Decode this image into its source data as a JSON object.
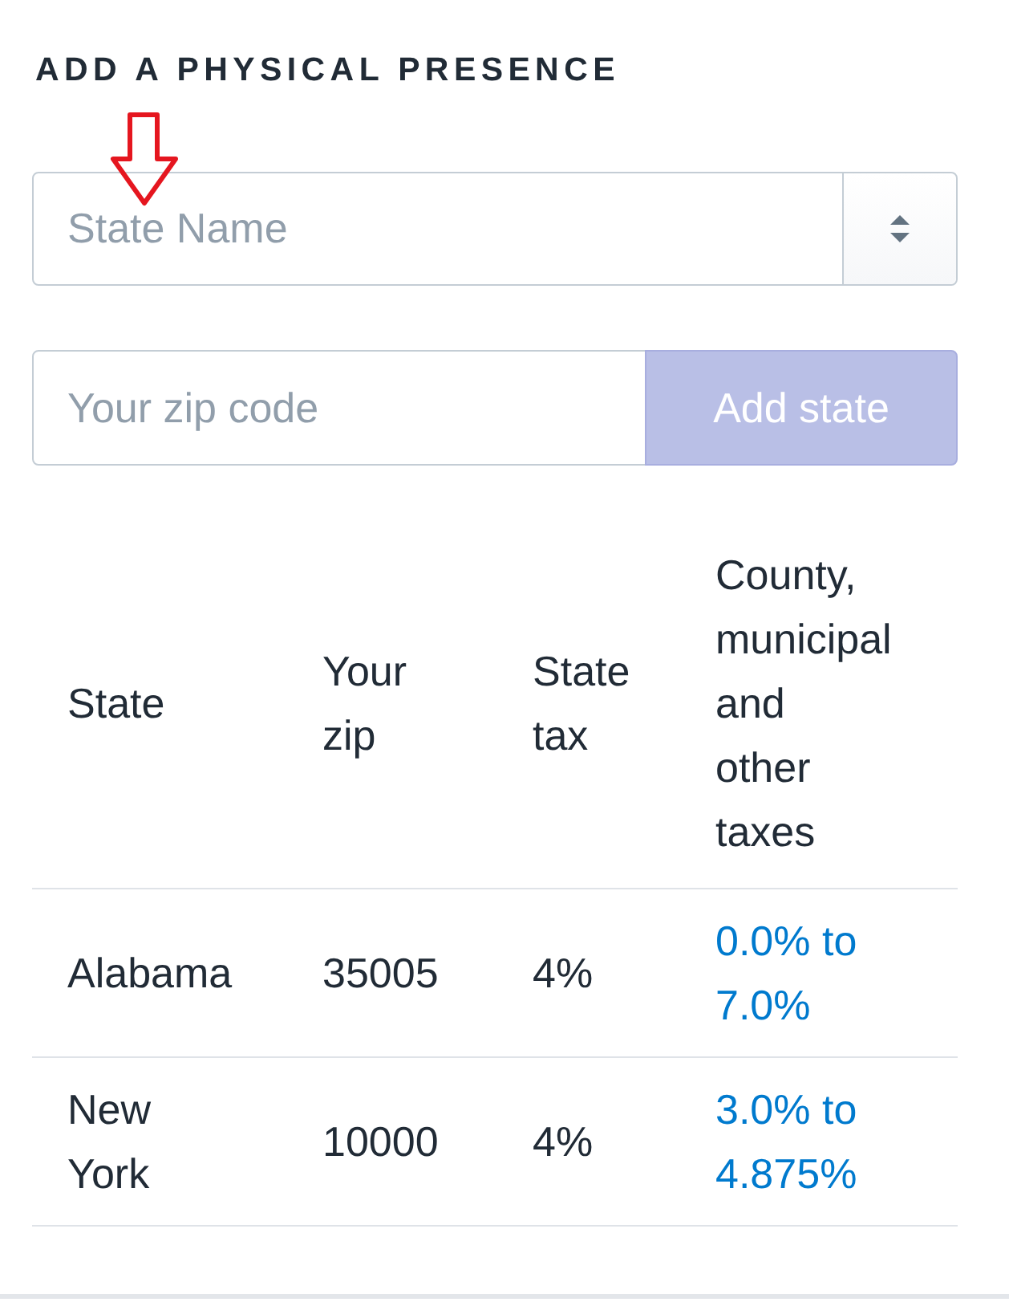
{
  "section_title": "ADD A PHYSICAL PRESENCE",
  "annotations": [
    {
      "kind": "arrow"
    }
  ],
  "state_select": {
    "placeholder": "State Name"
  },
  "zip_field": {
    "placeholder": "Your zip code"
  },
  "add_button": {
    "label": "Add state",
    "disabled": true
  },
  "table": {
    "columns": [
      {
        "label": "State",
        "kind": "text"
      },
      {
        "label": "Your zip",
        "kind": "text"
      },
      {
        "label": "State tax",
        "kind": "text"
      },
      {
        "label": "County, municipal and other taxes",
        "kind": "link"
      }
    ],
    "rows": [
      {
        "cells": [
          "Alabama",
          "35005",
          "4%",
          "0.0% to 7.0%"
        ]
      },
      {
        "cells": [
          "New York",
          "10000",
          "4%",
          "3.0% to 4.875%"
        ]
      }
    ]
  }
}
